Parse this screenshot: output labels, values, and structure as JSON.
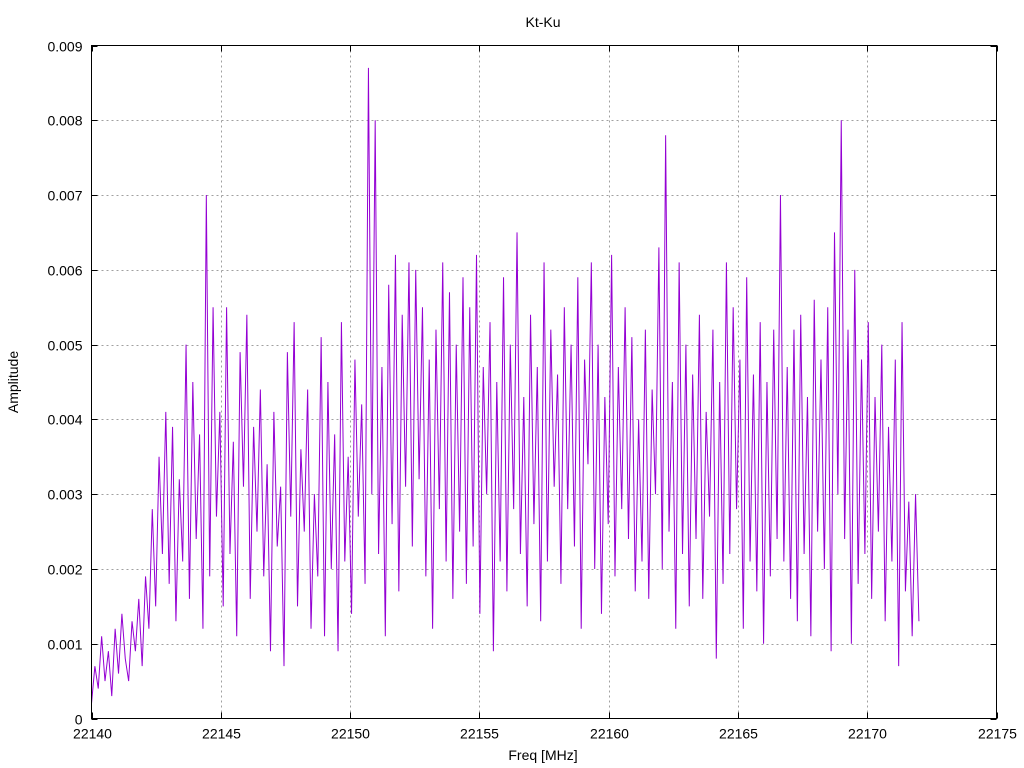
{
  "chart_data": {
    "type": "line",
    "title": "Kt-Ku",
    "xlabel": "Freq [MHz]",
    "ylabel": "Amplitude",
    "xlim": [
      22140,
      22175
    ],
    "ylim": [
      0,
      0.009
    ],
    "x_ticks": [
      22140,
      22145,
      22150,
      22155,
      22160,
      22165,
      22170,
      22175
    ],
    "x_tick_labels": [
      "22140",
      "22145",
      "22150",
      "22155",
      "22160",
      "22165",
      "22170",
      "22175"
    ],
    "y_ticks": [
      0,
      0.001,
      0.002,
      0.003,
      0.004,
      0.005,
      0.006,
      0.007,
      0.008,
      0.009
    ],
    "y_tick_labels": [
      "0",
      "0.001",
      "0.002",
      "0.003",
      "0.004",
      "0.005",
      "0.006",
      "0.007",
      "0.008",
      "0.009"
    ],
    "grid": true,
    "series_color": "#9400d3",
    "series": [
      {
        "x_start": 22140,
        "x_end": 22172,
        "values": [
          0.0002,
          0.0007,
          0.0004,
          0.0011,
          0.0005,
          0.0009,
          0.0003,
          0.0012,
          0.0006,
          0.0014,
          0.0008,
          0.0005,
          0.0013,
          0.0009,
          0.0016,
          0.0007,
          0.0019,
          0.0012,
          0.0028,
          0.0015,
          0.0035,
          0.0022,
          0.0041,
          0.0018,
          0.0039,
          0.0013,
          0.0032,
          0.0021,
          0.005,
          0.0016,
          0.0045,
          0.0024,
          0.0038,
          0.0012,
          0.007,
          0.0019,
          0.0055,
          0.0027,
          0.0041,
          0.0015,
          0.0055,
          0.0022,
          0.0037,
          0.0011,
          0.0049,
          0.0031,
          0.0054,
          0.0016,
          0.0039,
          0.0025,
          0.0044,
          0.0019,
          0.0034,
          0.0009,
          0.0041,
          0.0023,
          0.0031,
          0.0007,
          0.0049,
          0.0027,
          0.0053,
          0.0015,
          0.0036,
          0.0025,
          0.0044,
          0.0012,
          0.003,
          0.0019,
          0.0051,
          0.0011,
          0.0045,
          0.002,
          0.0038,
          0.0009,
          0.0053,
          0.0021,
          0.0035,
          0.0014,
          0.0048,
          0.0027,
          0.0042,
          0.0018,
          0.0087,
          0.003,
          0.008,
          0.0022,
          0.0047,
          0.0011,
          0.0058,
          0.0026,
          0.0062,
          0.0017,
          0.0054,
          0.0031,
          0.0061,
          0.0023,
          0.006,
          0.0032,
          0.0055,
          0.0019,
          0.0048,
          0.0012,
          0.0052,
          0.0028,
          0.0061,
          0.0021,
          0.0057,
          0.0016,
          0.005,
          0.0025,
          0.0059,
          0.0018,
          0.0055,
          0.0023,
          0.0062,
          0.0014,
          0.0047,
          0.003,
          0.0053,
          0.0009,
          0.0045,
          0.0021,
          0.0059,
          0.0017,
          0.005,
          0.0028,
          0.0065,
          0.0022,
          0.0043,
          0.0015,
          0.0054,
          0.0026,
          0.0047,
          0.0013,
          0.0061,
          0.0021,
          0.0052,
          0.0031,
          0.0046,
          0.0018,
          0.0055,
          0.0028,
          0.005,
          0.0023,
          0.0059,
          0.0012,
          0.0048,
          0.0034,
          0.0061,
          0.002,
          0.005,
          0.0014,
          0.0043,
          0.0026,
          0.0062,
          0.0019,
          0.0047,
          0.0028,
          0.0055,
          0.0024,
          0.0051,
          0.0017,
          0.004,
          0.0021,
          0.0052,
          0.0016,
          0.0044,
          0.003,
          0.0063,
          0.002,
          0.0078,
          0.0025,
          0.0045,
          0.0012,
          0.0061,
          0.0022,
          0.005,
          0.0015,
          0.0046,
          0.0024,
          0.0054,
          0.0016,
          0.0041,
          0.0027,
          0.0052,
          0.0008,
          0.0045,
          0.0018,
          0.0061,
          0.0022,
          0.0055,
          0.0028,
          0.0048,
          0.0012,
          0.0059,
          0.0021,
          0.0046,
          0.0017,
          0.0053,
          0.001,
          0.0045,
          0.0019,
          0.0052,
          0.0024,
          0.007,
          0.0021,
          0.0047,
          0.0016,
          0.0052,
          0.0013,
          0.0054,
          0.0022,
          0.0043,
          0.0011,
          0.0056,
          0.0025,
          0.0048,
          0.002,
          0.0055,
          0.0009,
          0.0065,
          0.003,
          0.008,
          0.0024,
          0.0052,
          0.001,
          0.006,
          0.0018,
          0.0048,
          0.0022,
          0.0053,
          0.0016,
          0.0043,
          0.0025,
          0.005,
          0.0013,
          0.0039,
          0.0021,
          0.0048,
          0.0007,
          0.0053,
          0.0017,
          0.0029,
          0.0011,
          0.003,
          0.0013
        ]
      }
    ]
  }
}
